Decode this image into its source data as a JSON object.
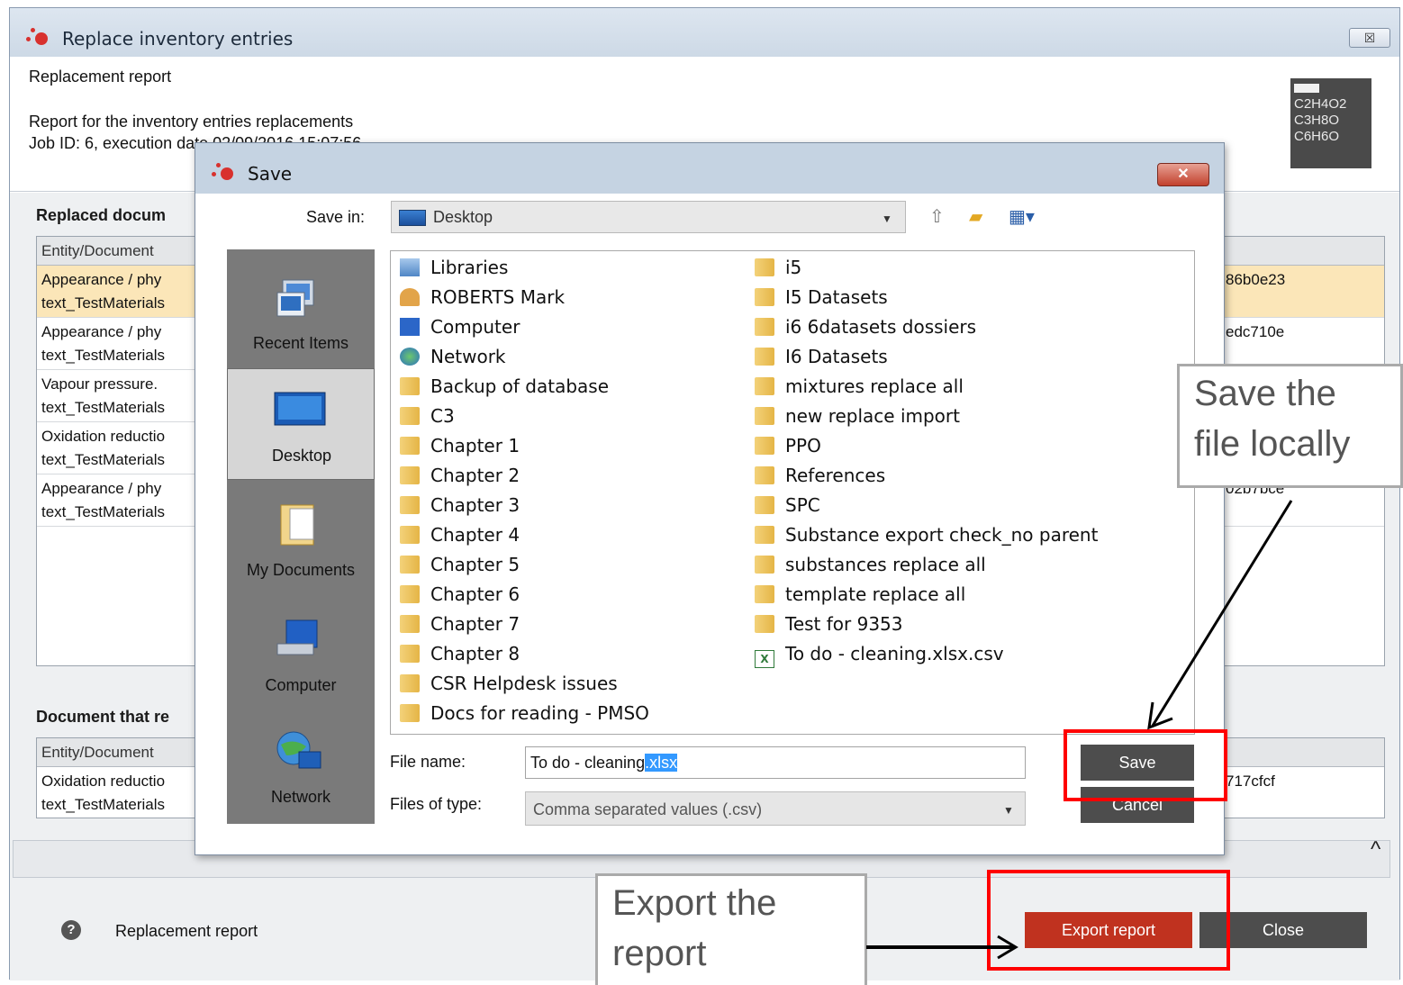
{
  "window": {
    "title": "Replace inventory entries",
    "close_label": "☒"
  },
  "header": {
    "section": "Replacement report",
    "line1": "Report for the inventory entries replacements",
    "line2": "Job ID: 6, execution date 02/09/2016 15:07:56",
    "logo_lines": [
      "C2H4O2",
      "C3H8O",
      "C6H6O"
    ]
  },
  "replaced": {
    "title": "Replaced docum",
    "column": "Entity/Document",
    "rows": [
      {
        "l1": "Appearance / phy",
        "l2": "text_TestMaterials",
        "right": "86b0e23"
      },
      {
        "l1": "Appearance / phy",
        "l2": "text_TestMaterials",
        "right": "edc710e"
      },
      {
        "l1": "Vapour pressure.",
        "l2": "text_TestMaterials",
        "right": ""
      },
      {
        "l1": "Oxidation reductio",
        "l2": "text_TestMaterials",
        "right": ""
      },
      {
        "l1": "Appearance / phy",
        "l2": "text_TestMaterials",
        "right": "02b7bce"
      }
    ]
  },
  "document": {
    "title": "Document that re",
    "column": "Entity/Document",
    "rows": [
      {
        "l1": "Oxidation reductio",
        "l2": "text_TestMaterials",
        "right": "717cfcf"
      }
    ]
  },
  "footer": {
    "help_icon": "?",
    "help_text": "Replacement report",
    "export_label": "Export report",
    "close_label": "Close"
  },
  "save_dialog": {
    "title": "Save",
    "close_label": "✕",
    "save_in_label": "Save in:",
    "save_in_value": "Desktop",
    "places": [
      "Recent Items",
      "Desktop",
      "My Documents",
      "Computer",
      "Network"
    ],
    "files_left": [
      "Libraries",
      "ROBERTS Mark",
      "Computer",
      "Network",
      "Backup of database",
      "C3",
      "Chapter 1",
      "Chapter 2",
      "Chapter 3",
      "Chapter 4",
      "Chapter 5",
      "Chapter 6",
      "Chapter 7",
      "Chapter 8",
      "CSR Helpdesk issues",
      "Docs for reading - PMSO"
    ],
    "files_right": [
      "i5",
      "I5 Datasets",
      "i6 6datasets dossiers",
      "I6 Datasets",
      "mixtures replace all",
      "new replace import",
      "PPO",
      "References",
      "SPC",
      "Substance export check_no parent",
      "substances replace all",
      "template replace all",
      "Test for 9353",
      "To do - cleaning.xlsx.csv"
    ],
    "file_name_label": "File name:",
    "file_name_value": "To do - cleaning",
    "file_name_selected": ".xlsx",
    "file_type_label": "Files of type:",
    "file_type_value": "Comma separated values (.csv)",
    "save_label": "Save",
    "cancel_label": "Cancel"
  },
  "annotations": {
    "save_callout_l1": "Save the",
    "save_callout_l2": "file locally",
    "export_callout_l1": "Export the",
    "export_callout_l2": "report",
    "highlight_color": "#ff0000"
  }
}
